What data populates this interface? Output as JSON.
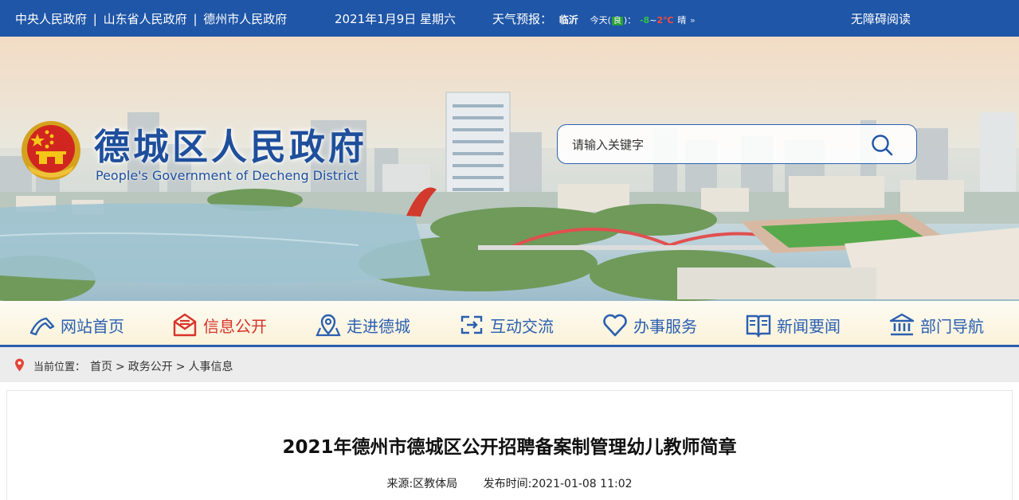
{
  "topbar": {
    "links": [
      "中央人民政府",
      "山东省人民政府",
      "德州市人民政府"
    ],
    "separator": "|",
    "date": "2021年1月9日 星期六",
    "weather": {
      "label": "天气预报：",
      "city": "临沂",
      "today": "今天(",
      "aqi": "良",
      "aqi_suffix": ")：",
      "low": "-8",
      "tilde": "~",
      "high": "2℃",
      "condition": "晴",
      "more": "»"
    },
    "accessibility": "无障碍阅读"
  },
  "header": {
    "title": "德城区人民政府",
    "subtitle": "People's Government of Decheng District",
    "search_placeholder": "请输入关键字"
  },
  "nav": {
    "items": [
      {
        "label": "网站首页",
        "icon": "home-icon"
      },
      {
        "label": "信息公开",
        "icon": "mail-icon",
        "active": true
      },
      {
        "label": "走进德城",
        "icon": "map-pin-icon"
      },
      {
        "label": "互动交流",
        "icon": "exchange-icon"
      },
      {
        "label": "办事服务",
        "icon": "heart-icon"
      },
      {
        "label": "新闻要闻",
        "icon": "book-icon"
      },
      {
        "label": "部门导航",
        "icon": "bank-icon"
      }
    ]
  },
  "breadcrumb": {
    "prefix": "当前位置：",
    "items": [
      "首页",
      "政务公开",
      "人事信息"
    ],
    "separator": ">"
  },
  "article": {
    "title": "2021年德州市德城区公开招聘备案制管理幼儿教师简章",
    "source": "来源:区教体局",
    "published": "发布时间:2021-01-08 11:02"
  },
  "colors": {
    "brand_blue": "#1f56a7",
    "nav_text": "#2a5fb0",
    "active_red": "#d8342a"
  }
}
